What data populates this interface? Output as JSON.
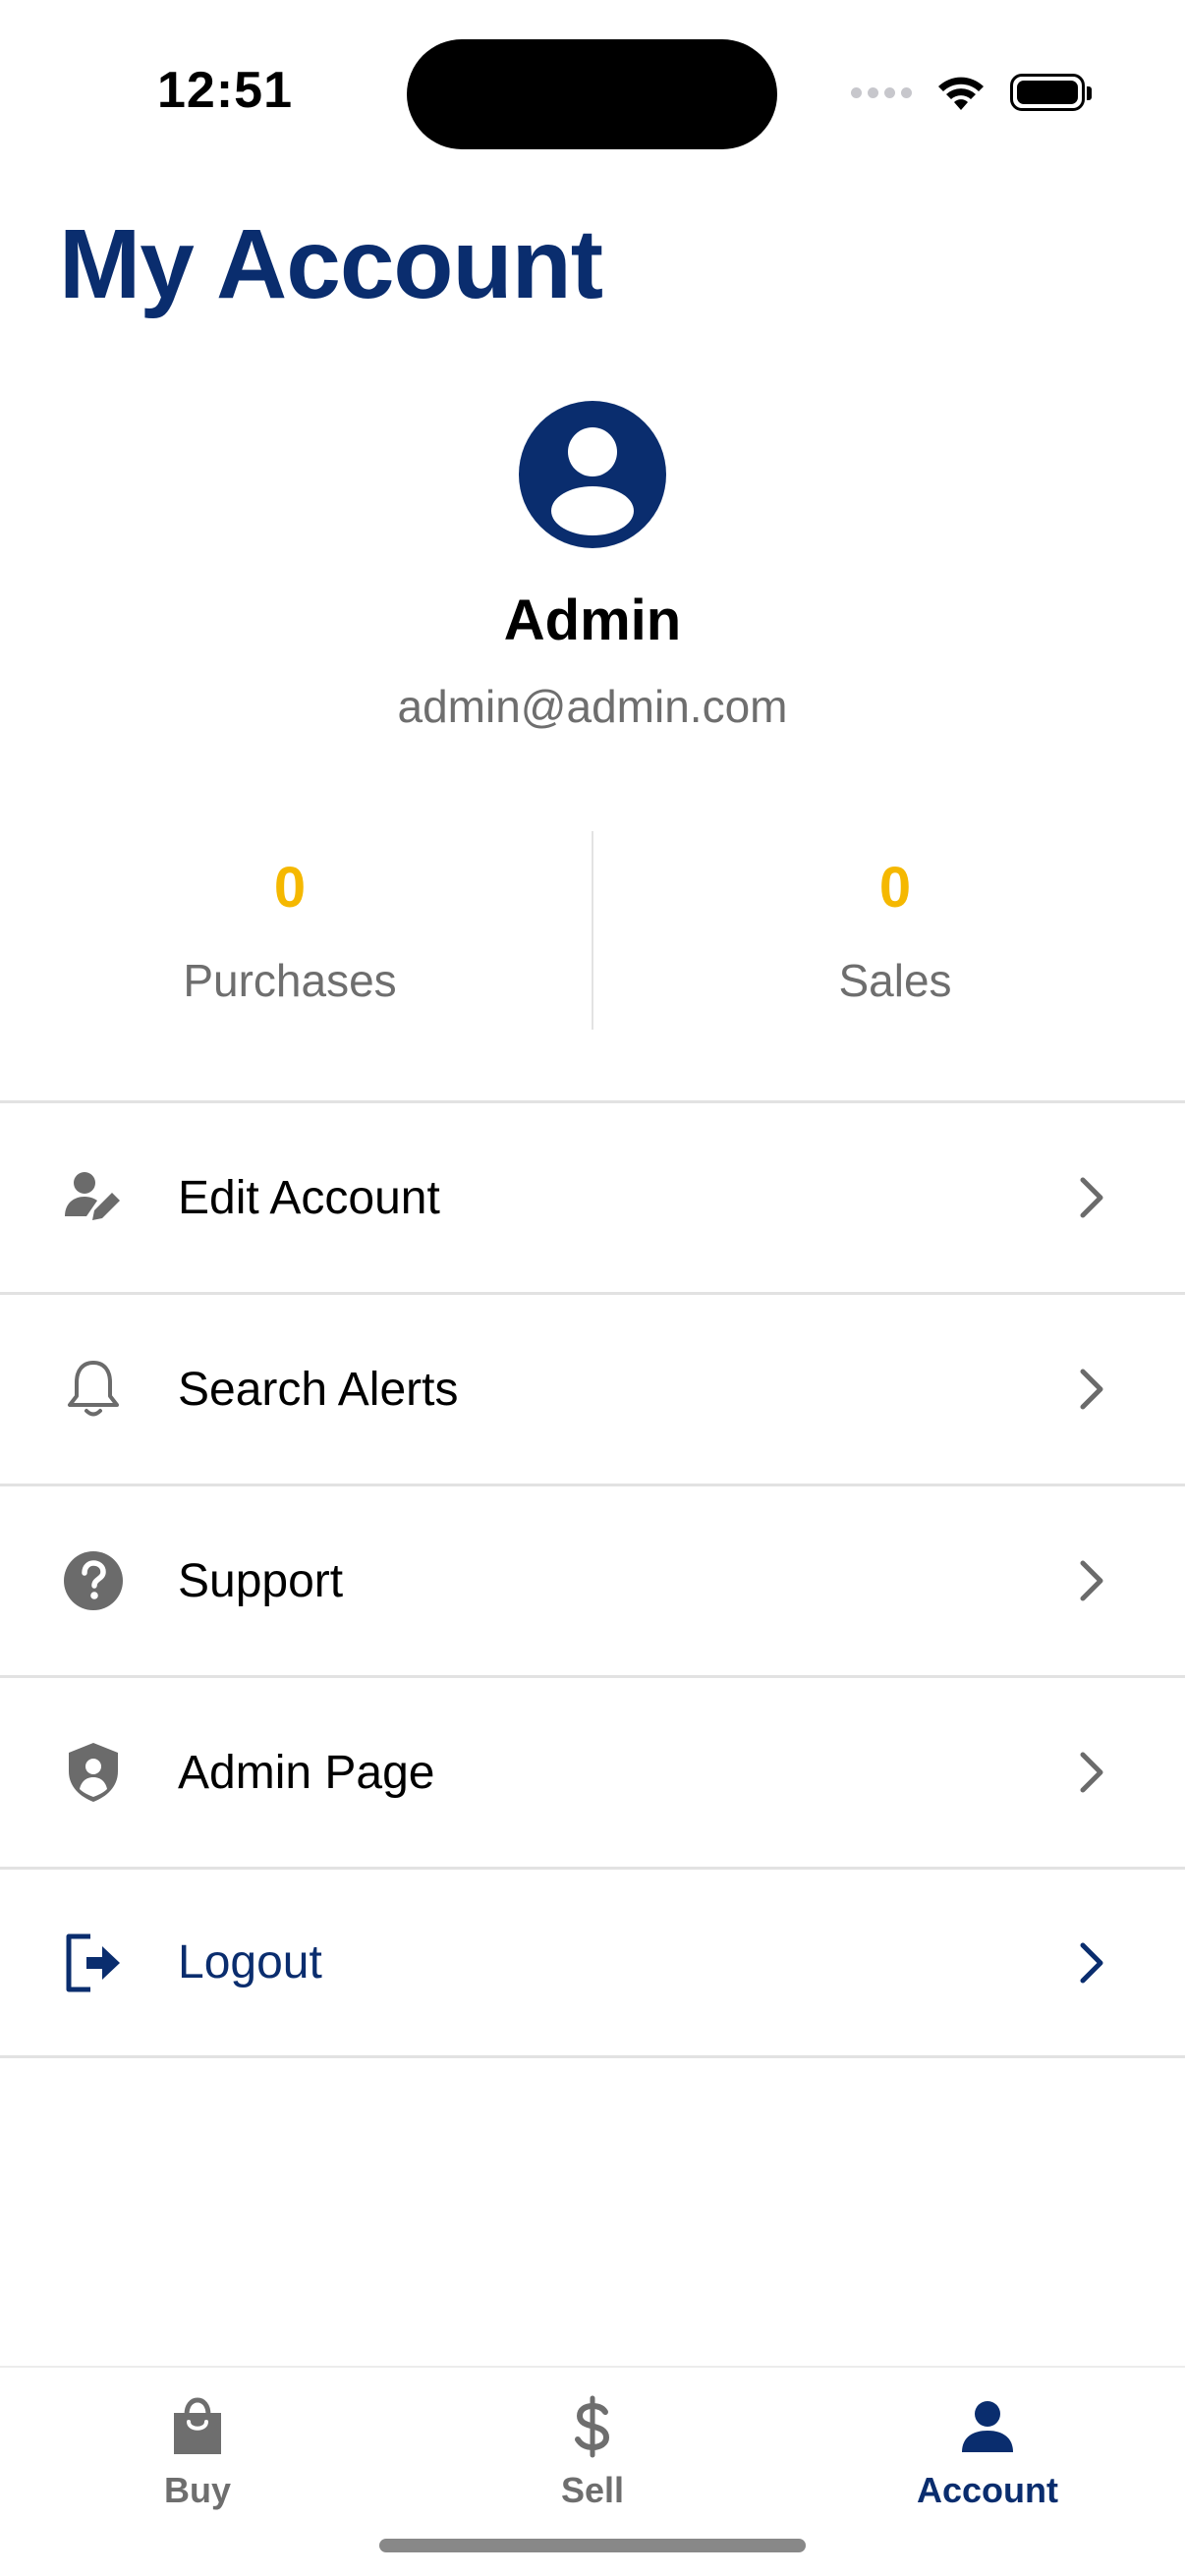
{
  "status_bar": {
    "time": "12:51"
  },
  "header": {
    "title": "My Account"
  },
  "profile": {
    "name": "Admin",
    "email": "admin@admin.com"
  },
  "stats": [
    {
      "value": "0",
      "label": "Purchases"
    },
    {
      "value": "0",
      "label": "Sales"
    }
  ],
  "menu": {
    "items": [
      {
        "label": "Edit Account",
        "icon": "user-edit-icon"
      },
      {
        "label": "Search Alerts",
        "icon": "bell-icon"
      },
      {
        "label": "Support",
        "icon": "question-circle-icon"
      },
      {
        "label": "Admin Page",
        "icon": "shield-user-icon"
      },
      {
        "label": "Logout",
        "icon": "logout-icon"
      }
    ]
  },
  "tabbar": {
    "tabs": [
      {
        "label": "Buy",
        "icon": "shopping-bag-icon",
        "active": false
      },
      {
        "label": "Sell",
        "icon": "dollar-icon",
        "active": false
      },
      {
        "label": "Account",
        "icon": "person-icon",
        "active": true
      }
    ]
  },
  "colors": {
    "brand": "#0a2d6e",
    "accent": "#f5b800",
    "muted_text": "#6e6e6e",
    "icon_gray": "#6b6b6b",
    "divider": "#e2e2e2"
  }
}
